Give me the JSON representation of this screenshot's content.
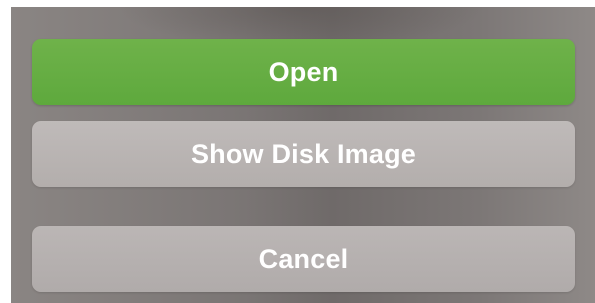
{
  "dialog": {
    "buttons": {
      "open_label": "Open",
      "show_disk_image_label": "Show Disk Image",
      "cancel_label": "Cancel"
    },
    "colors": {
      "primary_button": "#62ab40",
      "secondary_button": "#b7b2b1",
      "backdrop": "#7a7574",
      "button_text": "#ffffff"
    }
  }
}
